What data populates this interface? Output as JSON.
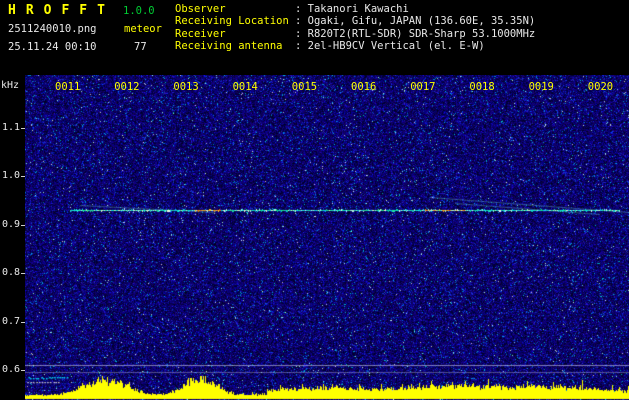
{
  "header": {
    "app_name": "HROFFT",
    "version": "1.0.0",
    "filename": "2511240010.png",
    "mode": "meteor",
    "datetime": "25.11.24 00:10",
    "count": "77",
    "info": [
      {
        "label": "Observer",
        "value": ": Takanori Kawachi"
      },
      {
        "label": "Receiving Location",
        "value": ": Ogaki, Gifu, JAPAN (136.60E, 35.35N)"
      },
      {
        "label": "Receiver",
        "value": ": R820T2(RTL-SDR) SDR-Sharp 53.1000MHz"
      },
      {
        "label": "Receiving antenna",
        "value": ": 2el-HB9CV Vertical (el. E-W)"
      }
    ]
  },
  "chart_data": {
    "type": "heatmap",
    "title": "HROFFT meteor radio echo spectrogram 00:10-00:20",
    "ylabel": "kHz",
    "y_ticks": [
      "1.1",
      "1.0",
      "0.9",
      "0.8",
      "0.7",
      "0.6"
    ],
    "x_ticks": [
      "0011",
      "0012",
      "0013",
      "0014",
      "0015",
      "0016",
      "0017",
      "0018",
      "0019",
      "0020"
    ],
    "y_range_khz": [
      0.55,
      1.2
    ],
    "carrier_line": {
      "freq_khz": 0.93,
      "x_start_frac": 0.074,
      "x_end_frac": 0.985,
      "hot_segments_xfrac": [
        [
          0.281,
          0.323
        ],
        [
          0.662,
          0.728
        ]
      ]
    },
    "interference_lines_khz": [
      0.61,
      0.595
    ],
    "meteor_traces": [
      {
        "x1_frac": 0.091,
        "f1_khz": 0.94,
        "x2_frac": 0.314,
        "f2_khz": 0.927
      },
      {
        "x1_frac": 0.67,
        "f1_khz": 0.957,
        "x2_frac": 1.0,
        "f2_khz": 0.926
      },
      {
        "x1_frac": 0.712,
        "f1_khz": 0.945,
        "x2_frac": 0.952,
        "f2_khz": 0.922
      }
    ],
    "activity_histogram": {
      "baseline": 2,
      "max": 21,
      "bursts": [
        {
          "x_frac": 0.132,
          "width_frac": 0.036,
          "amp": 15
        },
        {
          "x_frac": 0.29,
          "width_frac": 0.025,
          "amp": 18
        },
        {
          "x_frac": 0.5,
          "width_frac": 0.06,
          "amp": 4
        },
        {
          "x_frac": 0.7,
          "width_frac": 0.065,
          "amp": 5
        },
        {
          "x_frac": 0.86,
          "width_frac": 0.075,
          "amp": 5
        }
      ],
      "elevated_region_xfrac": [
        0.4,
        1.0
      ]
    },
    "noise": {
      "seed": 20241124,
      "base": "dark-blue speckle"
    }
  },
  "colors": {
    "accent_yellow": "#ffff00",
    "version_green": "#00cc33",
    "text_white": "#e8e8e8",
    "carrier_green": "#40ffb0",
    "histogram_yellow": "#ffff00",
    "noise_blue": "#0000a8"
  }
}
